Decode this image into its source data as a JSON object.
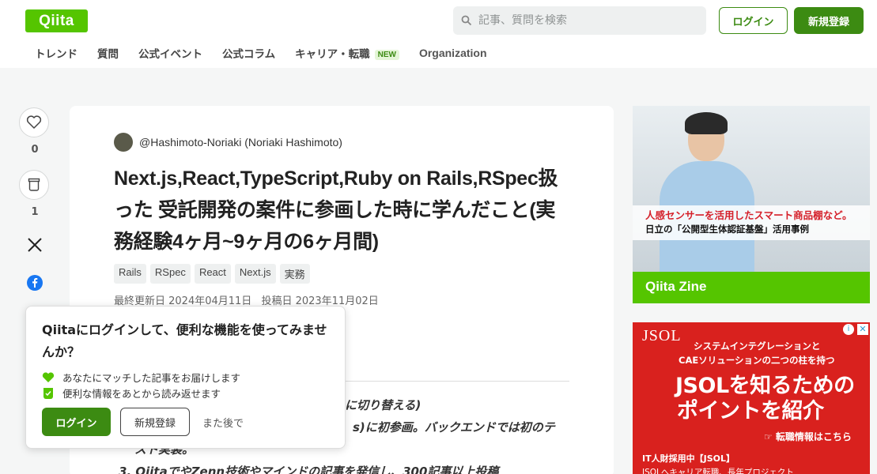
{
  "header": {
    "logo": "Qiita",
    "search_placeholder": "記事、質問を検索",
    "login": "ログイン",
    "signup": "新規登録",
    "nav": [
      "トレンド",
      "質問",
      "公式イベント",
      "公式コラム",
      "キャリア・転職",
      "Organization"
    ],
    "nav_badge": "NEW"
  },
  "rail": {
    "like_count": "0",
    "stock_count": "1"
  },
  "article": {
    "author": "@Hashimoto-Noriaki (Noriaki Hashimoto)",
    "title": "Next.js,React,TypeScript,Ruby on Rails,RSpec扱った 受託開発の案件に参画した時に学んだこと(実務経験4ヶ月~9ヶ月の6ヶ月間)",
    "tags": [
      "Rails",
      "RSpec",
      "React",
      "Next.js",
      "実務"
    ],
    "updated": "最終更新日 2024年04月11日",
    "posted": "投稿日 2023年11月02日",
    "body_fragments": [
      "に切り替える)",
      "s)に初参画。バックエンドでは初のテ",
      "スト実装。",
      "3. QiitaでやZenn技術やマインドの記事を発信し、300記事以上投稿"
    ]
  },
  "popup": {
    "title": "Qiitaにログインして、便利な機能を使ってみませんか？",
    "line1": "あなたにマッチした記事をお届けします",
    "line2": "便利な情報をあとから読み返せます",
    "login": "ログイン",
    "signup": "新規登録",
    "later": "また後で"
  },
  "ad1": {
    "line1": "人感センサーを活用したスマート商品棚など。",
    "line2": "日立の「公開型生体認証基盤」活用事例",
    "brand": "Qiita Zine"
  },
  "ad2": {
    "logo": "JSOL",
    "line1": "システムインテグレーションと",
    "line2": "CAEソリューションの二つの柱を持つ",
    "line3": "JSOLを知るための",
    "line4": "ポイントを紹介",
    "cta": "☞ 転職情報はこちら",
    "line5": "IT人財採用中【JSOL】",
    "line6": "JSOLへキャリア転職、長年プロジェクト"
  },
  "colors": {
    "brand_green": "#55c500",
    "button_green": "#3c8b12",
    "ad_red": "#d9211e"
  }
}
